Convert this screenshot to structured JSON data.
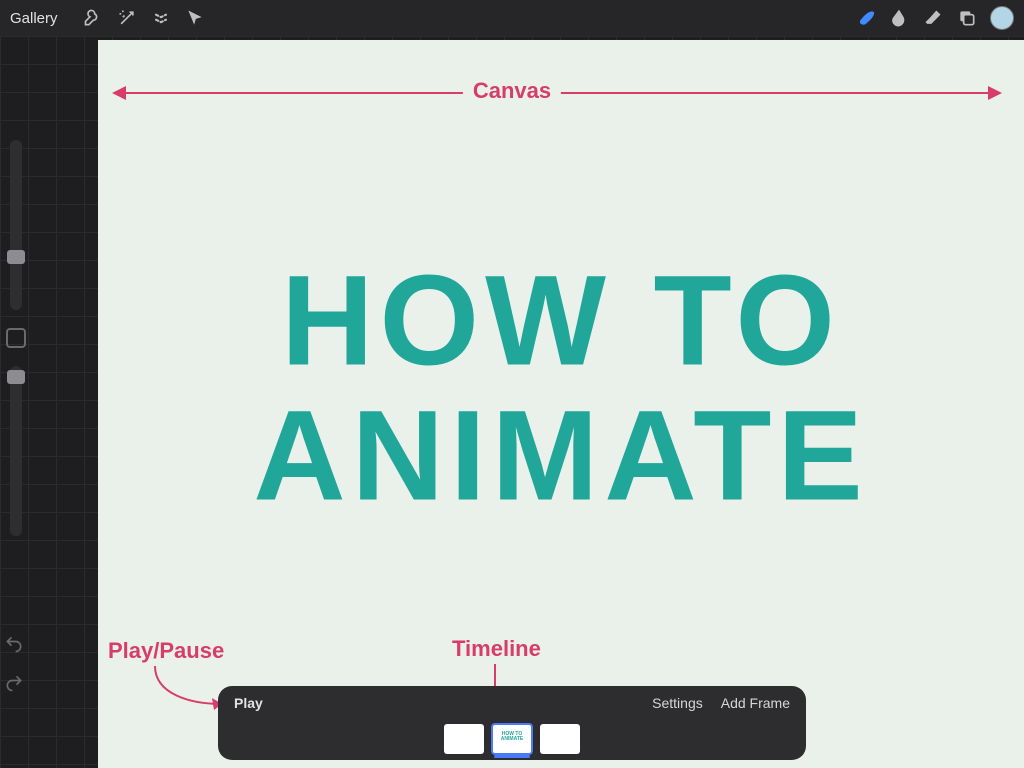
{
  "toolbar": {
    "gallery_label": "Gallery",
    "tools_left": [
      "wrench",
      "wand",
      "select",
      "cursor"
    ],
    "tools_right": [
      "brush",
      "smudge",
      "eraser",
      "layers",
      "color"
    ]
  },
  "canvas": {
    "line1": "HOW TO",
    "line2": "ANIMATE",
    "bg_color": "#e9f1ea",
    "text_color": "#20a79a"
  },
  "annotations": {
    "canvas_label": "Canvas",
    "play_pause_label": "Play/Pause",
    "timeline_label": "Timeline",
    "color": "#d83c6a"
  },
  "timeline": {
    "play_label": "Play",
    "settings_label": "Settings",
    "add_frame_label": "Add Frame",
    "frames": [
      {
        "active": false,
        "thumb": ""
      },
      {
        "active": true,
        "thumb": "HOW TO ANIMATE"
      },
      {
        "active": false,
        "thumb": ""
      }
    ]
  }
}
